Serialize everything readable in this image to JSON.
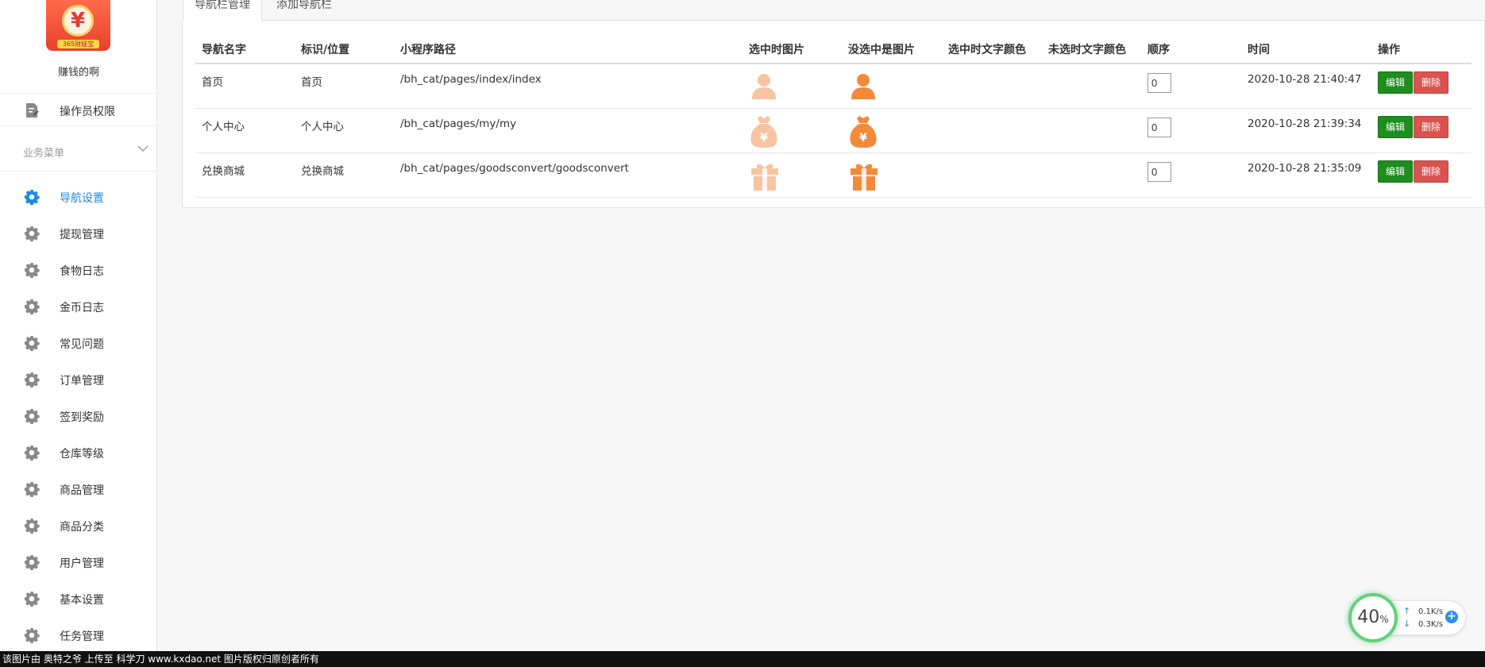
{
  "sidebar": {
    "user_name": "赚钱的啊",
    "logo_text": "365财娃宝",
    "operator_label": "操作员权限",
    "section_label": "业务菜单",
    "items": [
      {
        "label": "导航设置",
        "active": true
      },
      {
        "label": "提现管理"
      },
      {
        "label": "食物日志"
      },
      {
        "label": "金币日志"
      },
      {
        "label": "常见问题"
      },
      {
        "label": "订单管理"
      },
      {
        "label": "签到奖励"
      },
      {
        "label": "仓库等级"
      },
      {
        "label": "商品管理"
      },
      {
        "label": "商品分类"
      },
      {
        "label": "用户管理"
      },
      {
        "label": "基本设置"
      },
      {
        "label": "任务管理"
      }
    ]
  },
  "tabs": [
    {
      "label": "导航栏管理",
      "active": true
    },
    {
      "label": "添加导航栏"
    }
  ],
  "table": {
    "headers": [
      "导航名字",
      "标识/位置",
      "小程序路径",
      "选中时图片",
      "没选中是图片",
      "选中时文字颜色",
      "未选时文字颜色",
      "顺序",
      "时间",
      "操作"
    ],
    "rows": [
      {
        "name": "首页",
        "mark": "首页",
        "path": "/bh_cat/pages/index/index",
        "icon": "user-icon",
        "text_color_selected": "",
        "text_color_unselected": "",
        "order": "0",
        "time": "2020-10-28 21:40:47"
      },
      {
        "name": "个人中心",
        "mark": "个人中心",
        "path": "/bh_cat/pages/my/my",
        "icon": "money-bag-icon",
        "text_color_selected": "",
        "text_color_unselected": "",
        "order": "0",
        "time": "2020-10-28 21:39:34"
      },
      {
        "name": "兑换商城",
        "mark": "兑换商城",
        "path": "/bh_cat/pages/goodsconvert/goodsconvert",
        "icon": "gift-icon",
        "text_color_selected": "",
        "text_color_unselected": "",
        "order": "0",
        "time": "2020-10-28 21:35:09"
      }
    ],
    "edit_label": "编辑",
    "delete_label": "删除"
  },
  "colors": {
    "accent": "#1e88e5",
    "edit": "#1e8e1e",
    "delete": "#d9534f",
    "icon_orange": "#f28a3a",
    "icon_orange_faded": "#f7c4a3"
  },
  "net_widget": {
    "percent": "40",
    "percent_unit": "%",
    "up": "0.1K/s",
    "down": "0.3K/s"
  },
  "footer_text": "该图片由 奥特之爷 上传至 科学刀 www.kxdao.net 图片版权归原创者所有"
}
